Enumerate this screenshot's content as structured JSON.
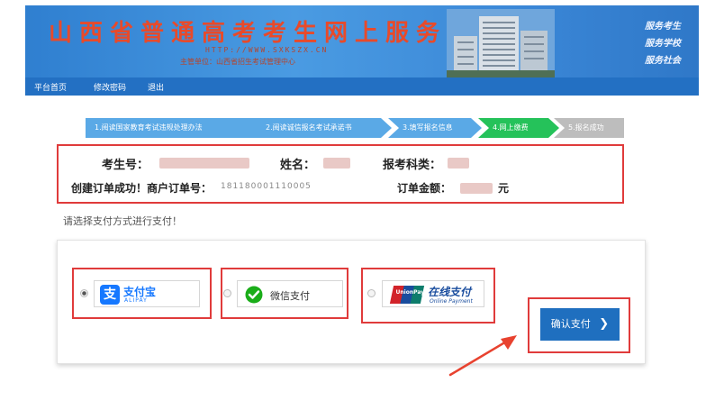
{
  "header": {
    "title": "山西省普通高考考生网上服务平台",
    "url": "HTTP://WWW.SXKSZX.CN",
    "sponsor": "主管单位：山西省招生考试管理中心",
    "slogans": [
      "服务考生",
      "服务学校",
      "服务社会"
    ]
  },
  "nav": {
    "items": [
      "平台首页",
      "修改密码",
      "退出"
    ]
  },
  "steps": [
    {
      "label": "1.阅读国家教育考试违规处理办法",
      "state": "done"
    },
    {
      "label": "2.阅读诚信报名考试承诺书",
      "state": "done"
    },
    {
      "label": "3.填写报名信息",
      "state": "done"
    },
    {
      "label": "4.网上缴费",
      "state": "current"
    },
    {
      "label": "5.报名成功",
      "state": "todo"
    }
  ],
  "order_info": {
    "candidate_no_label": "考生号：",
    "name_label": "姓名：",
    "category_label": "报考科类：",
    "order_no_label": "创建订单成功！商户订单号：",
    "order_no_value": "181180001110005",
    "amount_label": "订单金额：",
    "amount_unit": "元"
  },
  "payment": {
    "prompt": "请选择支付方式进行支付！",
    "options": [
      {
        "name": "支付宝",
        "sub": "ALIPAY",
        "selected": true
      },
      {
        "name": "微信支付",
        "selected": false
      },
      {
        "name": "在线支付",
        "sub": "Online Payment",
        "brand": "UnionPay",
        "selected": false
      }
    ],
    "confirm_label": "确认支付",
    "confirm_icon": "chevron-right-icon"
  },
  "colors": {
    "header_blue": "#3a86d6",
    "nav_blue": "#2370c3",
    "step_done": "#5aa9e6",
    "step_current": "#25c25a",
    "step_todo": "#bdbdbd",
    "highlight_red": "#e03b3b",
    "alipay_blue": "#1678ff",
    "wechat_green": "#1aad19",
    "unionpay_red": "#d2232a"
  }
}
